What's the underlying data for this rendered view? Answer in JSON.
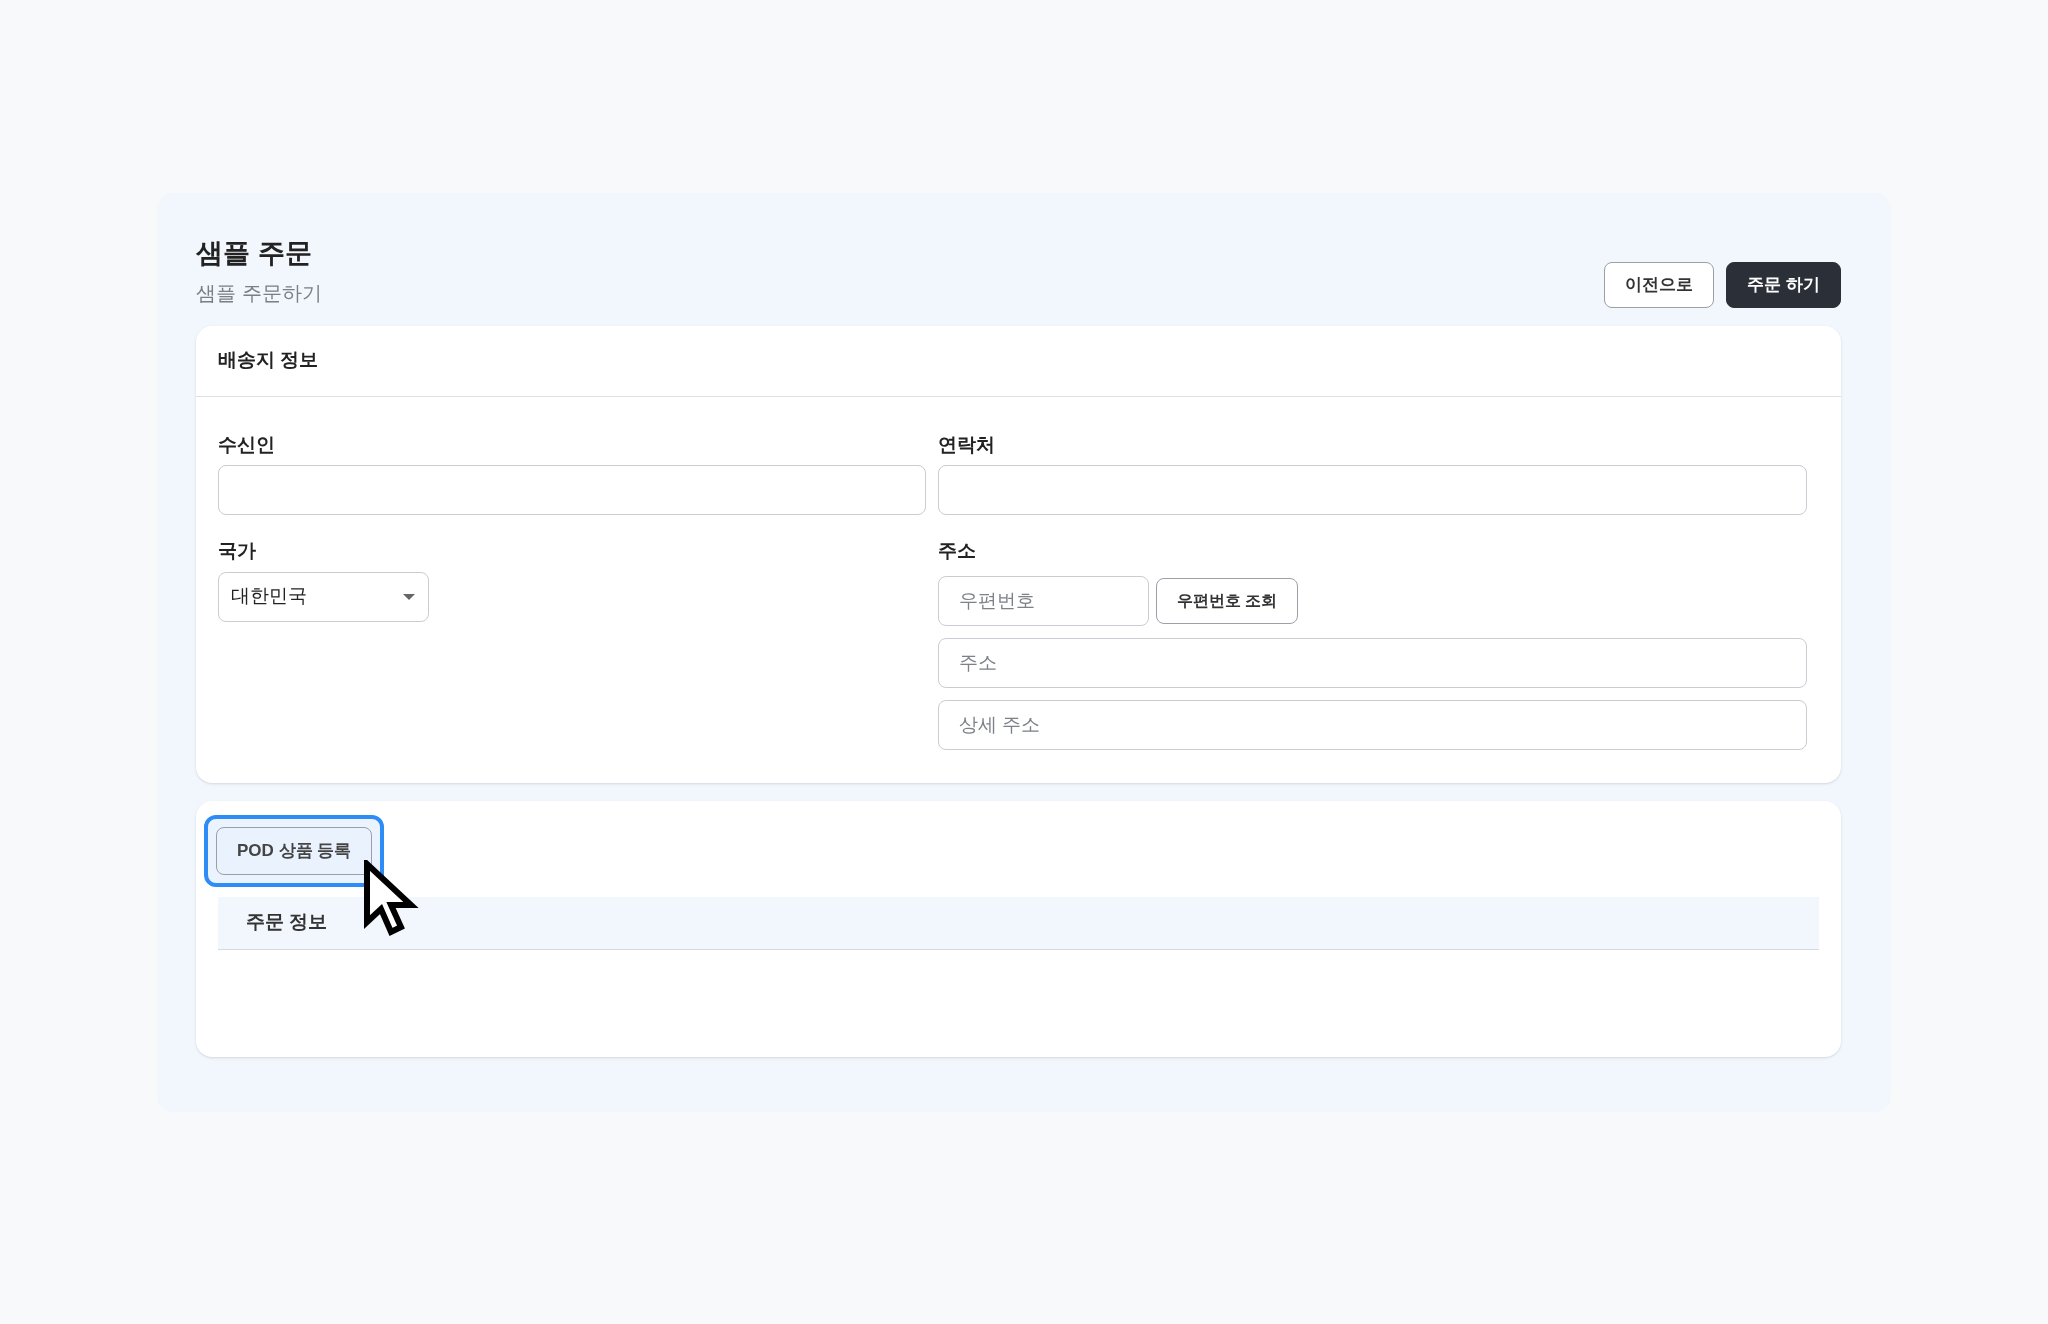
{
  "header": {
    "title": "샘플 주문",
    "subtitle": "샘플 주문하기"
  },
  "actions": [
    {
      "label": "이전으로",
      "kind": "secondary"
    },
    {
      "label": "주문 하기",
      "kind": "primary"
    }
  ],
  "shipping": {
    "title": "배송지 정보",
    "recipient": {
      "label": "수신인"
    },
    "contact": {
      "label": "연락처"
    },
    "country": {
      "label": "국가",
      "value": "대한민국"
    },
    "address": {
      "label": "주소",
      "postal_placeholder": "우편번호",
      "lookup_button": "우편번호 조회",
      "address_placeholder": "주소",
      "detail_placeholder": "상세 주소"
    }
  },
  "order": {
    "pod_button": {
      "label": "POD 상품 등록",
      "highlighted": true
    },
    "table": {
      "columns": [
        "주문 정보"
      ]
    }
  }
}
